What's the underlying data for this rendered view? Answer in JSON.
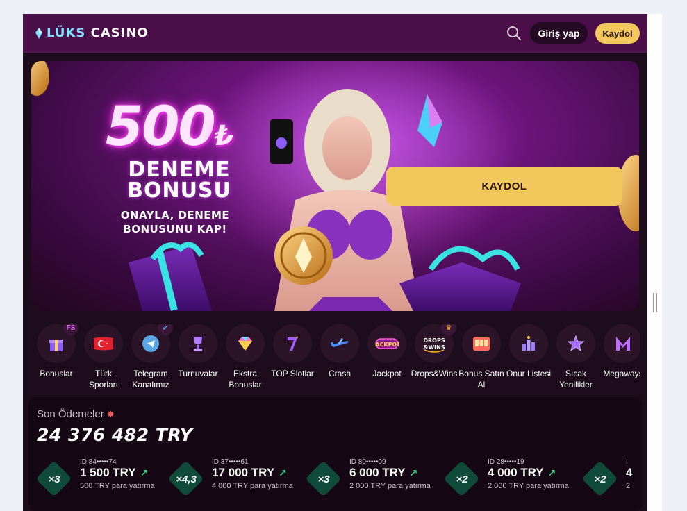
{
  "header": {
    "logo_part1": "LÜKS",
    "logo_part2": "CASINO",
    "search_icon": "search-icon",
    "login_label": "Giriş yap",
    "signup_label": "Kaydol"
  },
  "banner": {
    "amount": "500",
    "currency": "₺",
    "title": "DENEME BONUSU",
    "subtitle": "ONAYLA, DENEME BONUSUNU KAP!",
    "cta_label": "KAYDOL"
  },
  "categories": [
    {
      "label": "Bonuslar",
      "icon": "gift-icon",
      "badge": "FS"
    },
    {
      "label": "Türk Sporları",
      "icon": "turkish-flag-icon",
      "badge": ""
    },
    {
      "label": "Telegram Kanalımız",
      "icon": "telegram-icon",
      "badge": "↙"
    },
    {
      "label": "Turnuvalar",
      "icon": "trophy-icon",
      "badge": ""
    },
    {
      "label": "Ekstra Bonuslar",
      "icon": "diamond-icon",
      "badge": ""
    },
    {
      "label": "TOP Slotlar",
      "icon": "seven-icon",
      "badge": ""
    },
    {
      "label": "Crash",
      "icon": "plane-icon",
      "badge": ""
    },
    {
      "label": "Jackpot",
      "icon": "jackpot-icon",
      "badge": ""
    },
    {
      "label": "Drops&Wins",
      "icon": "drops-wins-icon",
      "badge": ""
    },
    {
      "label": "Bonus Satın Al",
      "icon": "slot-machine-icon",
      "badge": ""
    },
    {
      "label": "Onur Listesi",
      "icon": "leaderboard-icon",
      "badge": ""
    },
    {
      "label": "Sıcak Yenilikler",
      "icon": "star-icon",
      "badge": ""
    },
    {
      "label": "Megaways",
      "icon": "megaways-icon",
      "badge": ""
    }
  ],
  "payouts": {
    "title": "Son Ödemeler",
    "total": "24 376 482 TRY",
    "items": [
      {
        "mult": "×3",
        "id": "ID 84•••••74",
        "amount": "1 500 TRY",
        "deposit": "500 TRY para yatırma"
      },
      {
        "mult": "×4,3",
        "id": "ID 37•••••61",
        "amount": "17 000 TRY",
        "deposit": "4 000 TRY para yatırma"
      },
      {
        "mult": "×3",
        "id": "ID 80•••••09",
        "amount": "6 000 TRY",
        "deposit": "2 000 TRY para yatırma"
      },
      {
        "mult": "×2",
        "id": "ID 28•••••19",
        "amount": "4 000 TRY",
        "deposit": "2 000 TRY para yatırma"
      },
      {
        "mult": "×2",
        "id": "I",
        "amount": "4",
        "deposit": "2"
      }
    ]
  },
  "colors": {
    "header_bg": "#4a0f48",
    "accent_yellow": "#f2c75b",
    "app_bg": "#1c0c1c",
    "multiplier_green": "#104a3a"
  }
}
